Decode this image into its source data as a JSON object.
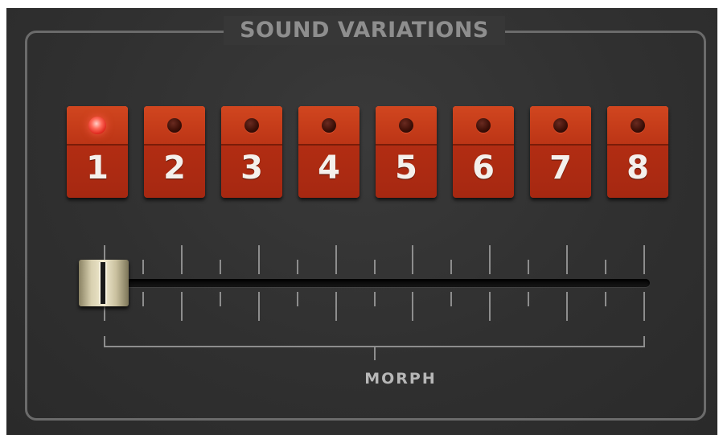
{
  "panel": {
    "title": "SOUND VARIATIONS"
  },
  "variations": {
    "buttons": [
      {
        "label": "1",
        "active": true
      },
      {
        "label": "2",
        "active": false
      },
      {
        "label": "3",
        "active": false
      },
      {
        "label": "4",
        "active": false
      },
      {
        "label": "5",
        "active": false
      },
      {
        "label": "6",
        "active": false
      },
      {
        "label": "7",
        "active": false
      },
      {
        "label": "8",
        "active": false
      }
    ]
  },
  "morph": {
    "label": "MORPH",
    "value": 0,
    "min": 0,
    "max": 1
  },
  "colors": {
    "button_red": "#b22d13",
    "led_on": "#ff5a48",
    "panel_bg": "#333333",
    "text_gray": "#8e8e8e"
  }
}
